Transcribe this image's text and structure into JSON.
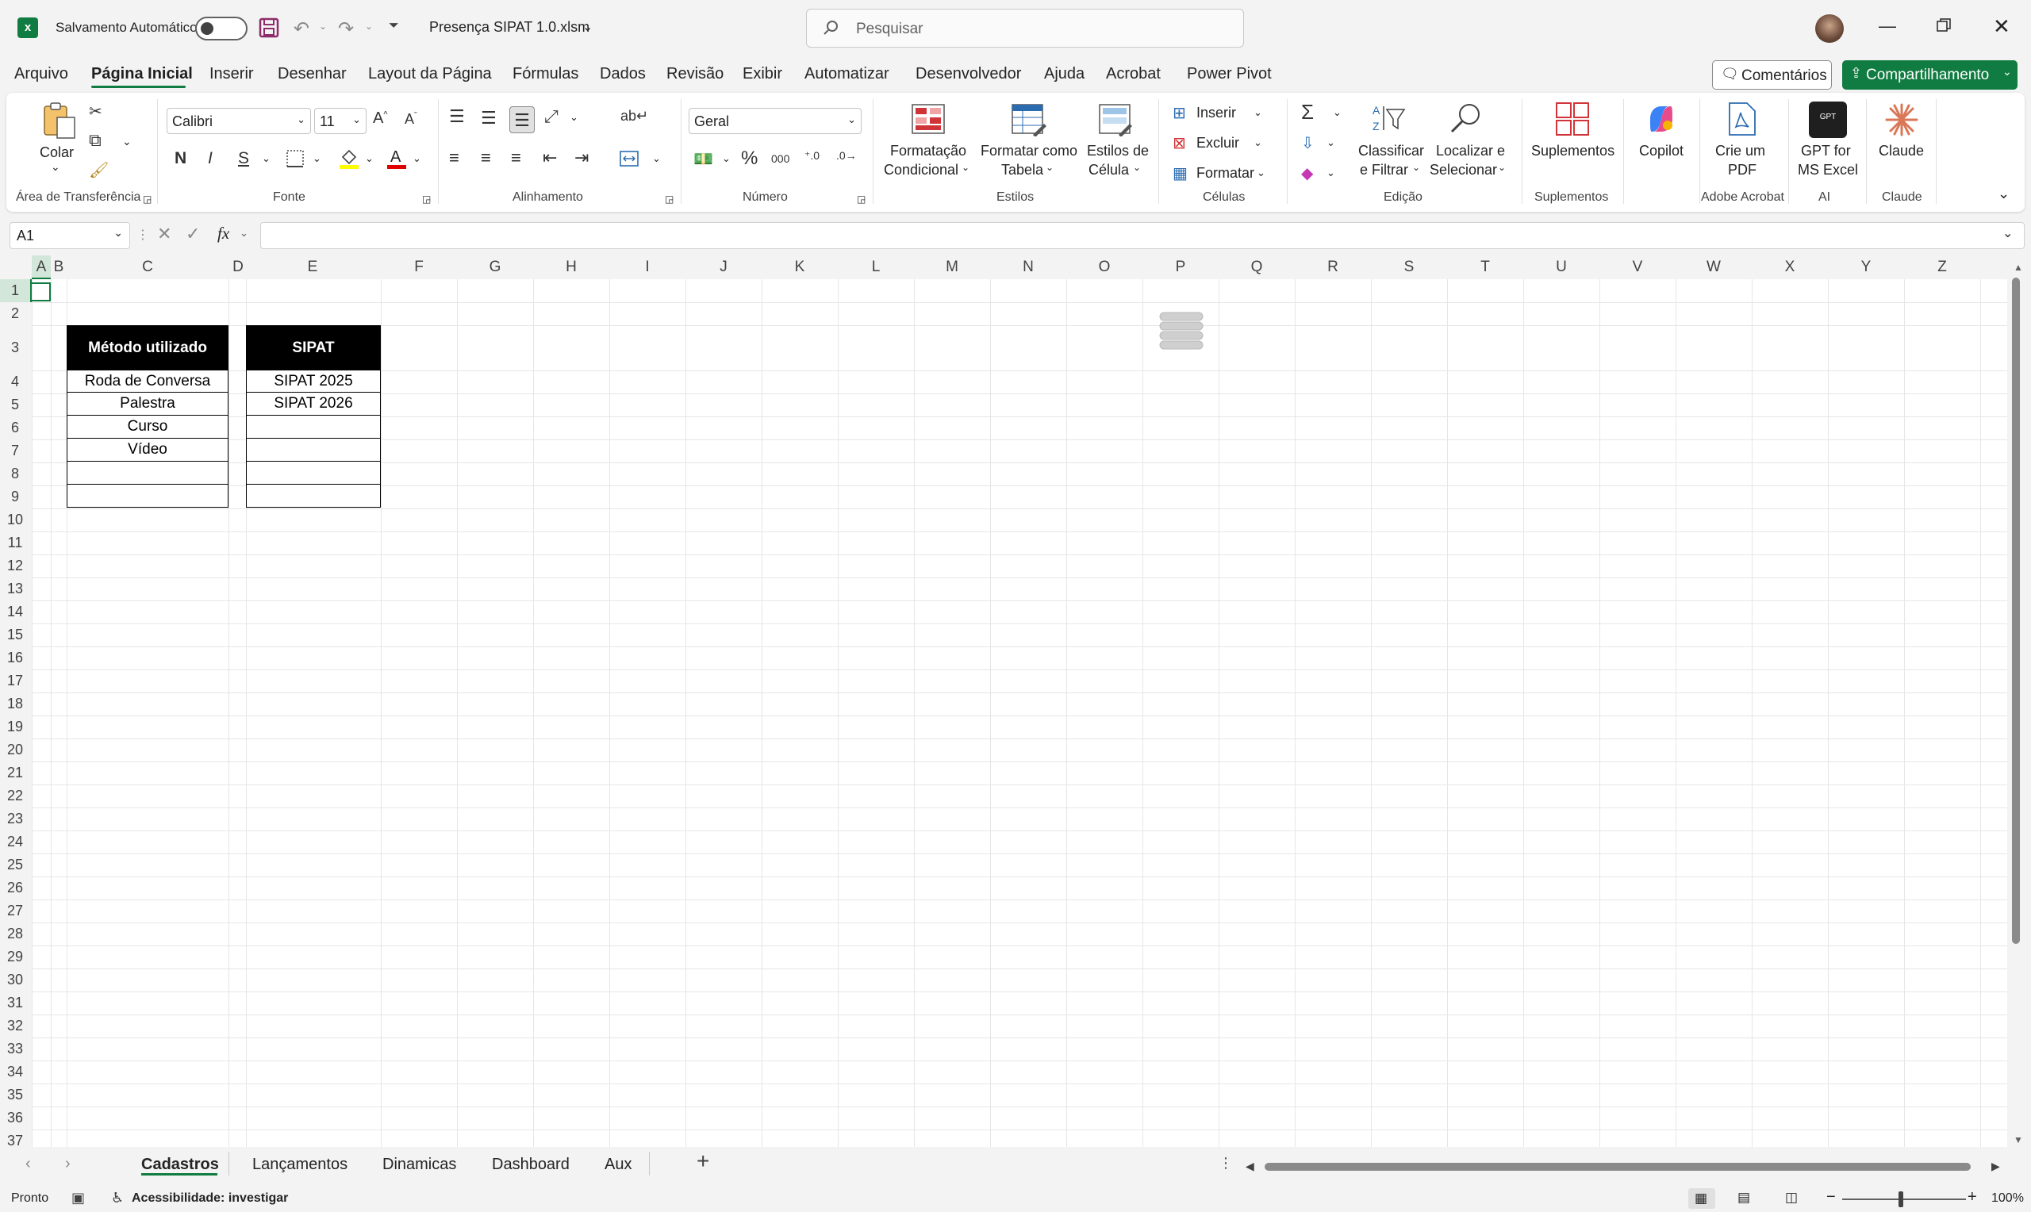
{
  "window": {
    "autosave_label": "Salvamento Automático",
    "file_title": "Presença SIPAT 1.0.xlsm",
    "search_placeholder": "Pesquisar"
  },
  "menu": {
    "items": [
      "Arquivo",
      "Página Inicial",
      "Inserir",
      "Desenhar",
      "Layout da Página",
      "Fórmulas",
      "Dados",
      "Revisão",
      "Exibir",
      "Automatizar",
      "Desenvolvedor",
      "Ajuda",
      "Acrobat",
      "Power Pivot"
    ],
    "active": "Página Inicial",
    "comments_label": "Comentários",
    "share_label": "Compartilhamento"
  },
  "ribbon": {
    "clipboard": {
      "paste_label": "Colar",
      "group": "Área de Transferência"
    },
    "font": {
      "name": "Calibri",
      "size": "11",
      "bold": "N",
      "italic": "I",
      "underline": "S",
      "group": "Fonte"
    },
    "alignment": {
      "group": "Alinhamento"
    },
    "number": {
      "format": "Geral",
      "group": "Número"
    },
    "styles": {
      "cond_format_1": "Formatação",
      "cond_format_2": "Condicional",
      "table_1": "Formatar como",
      "table_2": "Tabela",
      "cell_styles_1": "Estilos de",
      "cell_styles_2": "Célula",
      "group": "Estilos"
    },
    "cells": {
      "insert": "Inserir",
      "delete": "Excluir",
      "format": "Formatar",
      "group": "Células"
    },
    "editing": {
      "sort_1": "Classificar",
      "sort_2": "e Filtrar",
      "find_1": "Localizar e",
      "find_2": "Selecionar",
      "group": "Edição"
    },
    "addins": {
      "label": "Suplementos",
      "group": "Suplementos"
    },
    "copilot": {
      "label": "Copilot"
    },
    "acrobat": {
      "label_1": "Crie um",
      "label_2": "PDF",
      "group": "Adobe Acrobat"
    },
    "ai": {
      "label_1": "GPT for",
      "label_2": "MS Excel",
      "group": "AI"
    },
    "claude": {
      "label": "Claude",
      "group": "Claude"
    }
  },
  "formula_bar": {
    "name_box": "A1",
    "fx": "fx",
    "value": ""
  },
  "columns": [
    "A",
    "B",
    "C",
    "D",
    "E",
    "F",
    "G",
    "H",
    "I",
    "J",
    "K",
    "L",
    "M",
    "N",
    "O",
    "P",
    "Q",
    "R",
    "S",
    "T",
    "U",
    "V",
    "W",
    "X",
    "Y",
    "Z"
  ],
  "rows": [
    "1",
    "2",
    "3",
    "4",
    "5",
    "6",
    "7",
    "8",
    "9",
    "10",
    "11",
    "12",
    "13",
    "14",
    "15",
    "16",
    "17",
    "18",
    "19",
    "20",
    "21",
    "22",
    "23",
    "24",
    "25",
    "26",
    "27",
    "28",
    "29",
    "30",
    "31",
    "32",
    "33",
    "34",
    "35",
    "36",
    "37"
  ],
  "tables": {
    "metodo": {
      "header": "Método utilizado",
      "items": [
        "Roda de Conversa",
        "Palestra",
        "Curso",
        "Vídeo",
        "",
        ""
      ]
    },
    "sipat": {
      "header": "SIPAT",
      "items": [
        "SIPAT 2025",
        "SIPAT 2026",
        "",
        "",
        "",
        ""
      ]
    }
  },
  "sheet_tabs": {
    "items": [
      "Cadastros",
      "Lançamentos",
      "Dinamicas",
      "Dashboard",
      "Aux"
    ],
    "active": "Cadastros"
  },
  "status": {
    "ready": "Pronto",
    "accessibility": "Acessibilidade: investigar",
    "zoom": "100%"
  },
  "colors": {
    "accent": "#107c41",
    "header_fill": "#000000"
  }
}
